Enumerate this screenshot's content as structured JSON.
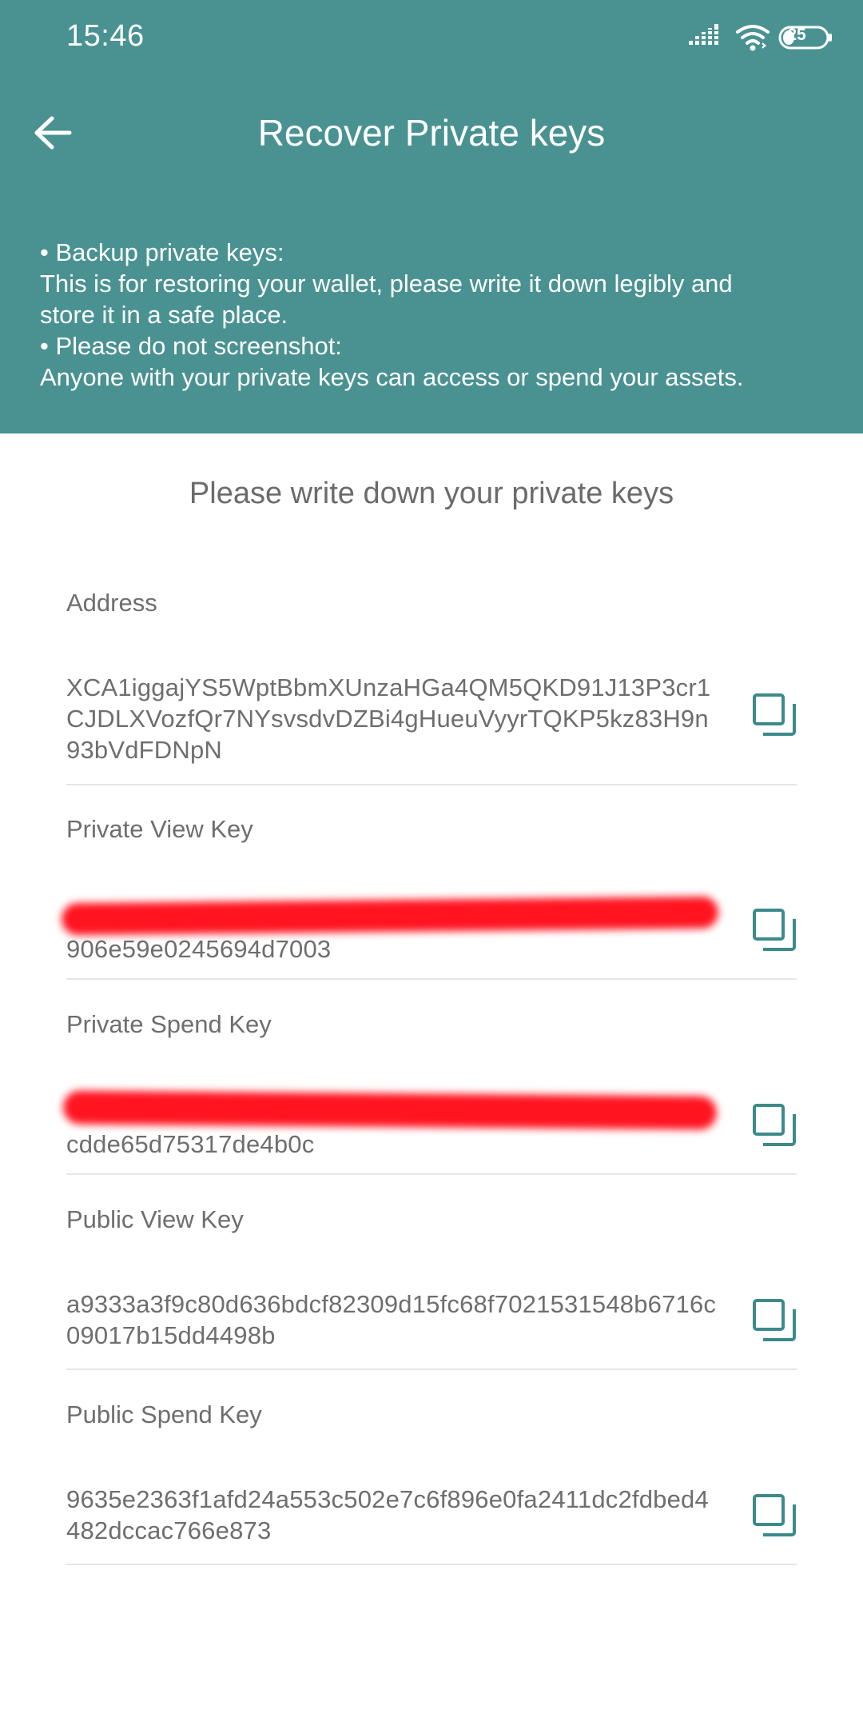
{
  "status_bar": {
    "time": "15:46",
    "battery": "25",
    "icons": [
      "signal-icon",
      "wifi-icon",
      "battery-icon"
    ]
  },
  "header": {
    "title": "Recover Private keys",
    "back_icon": "back-arrow-icon",
    "notice": {
      "line1": "• Backup private keys:",
      "line2": "This is for restoring your wallet, please write it down legibly and",
      "line3": "store it in a safe place.",
      "line4": "• Please do not screenshot:",
      "line5": "Anyone with your private keys can access or spend your assets."
    }
  },
  "subtitle": "Please write down your private keys",
  "keys": {
    "address": {
      "label": "Address",
      "value": "XCA1iggajYS5WptBbmXUnzaHGa4QM5QKD91J13P3cr1CJDLXVozfQr7NYsvsdvDZBi4gHueuVyyrTQKP5kz83H9n93bVdFDNpN"
    },
    "private_view_key": {
      "label": "Private View Key",
      "value_line2": "906e59e0245694d7003",
      "redacted": true
    },
    "private_spend_key": {
      "label": "Private Spend Key",
      "value_line2": "cdde65d75317de4b0c",
      "redacted": true
    },
    "public_view_key": {
      "label": "Public View Key",
      "value": "a9333a3f9c80d636bdcf82309d15fc68f7021531548b6716c09017b15dd4498b"
    },
    "public_spend_key": {
      "label": "Public Spend Key",
      "value": "9635e2363f1afd24a553c502e7c6f896e0fa2411dc2fdbed4482dccac766e873"
    }
  },
  "colors": {
    "header_bg": "#4a9292",
    "accent": "#3d8a8a",
    "text_gray": "#6e6e6e",
    "redaction": "#ff1420"
  }
}
